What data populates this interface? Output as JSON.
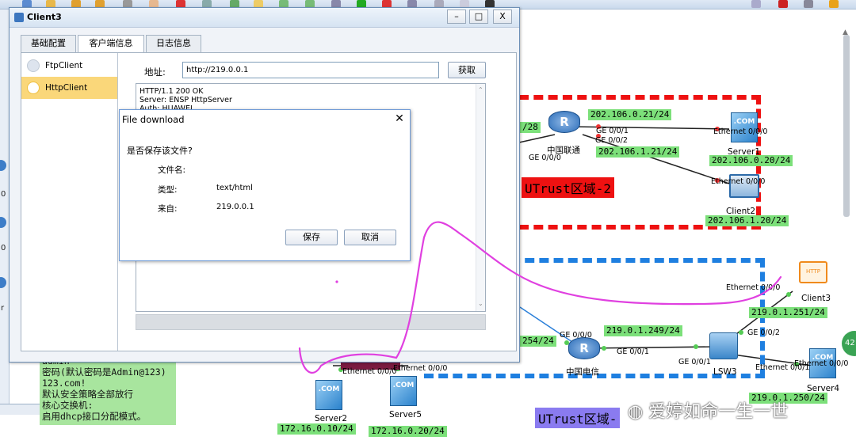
{
  "window": {
    "title": "Client3",
    "tabs": [
      "基础配置",
      "客户端信息",
      "日志信息"
    ],
    "active_tab": "客户端信息",
    "client_list": [
      "FtpClient",
      "HttpClient"
    ],
    "selected_client": "HttpClient",
    "address_label": "地址:",
    "address_value": "http://219.0.0.1",
    "fetch_button": "获取",
    "response_lines": [
      "HTTP/1.1 200 OK",
      "Server: ENSP HttpServer",
      "Auth: HUAWEI"
    ]
  },
  "dialog": {
    "title": "File download",
    "question": "是否保存该文件?",
    "filename_label": "文件名:",
    "filename_value": "",
    "type_label": "类型:",
    "type_value": "text/html",
    "from_label": "来自:",
    "from_value": "219.0.0.1",
    "save_button": "保存",
    "cancel_button": "取消"
  },
  "topology": {
    "zones": [
      {
        "name": "UTrust区域-2",
        "color": "#ee1111"
      },
      {
        "name": "UTrust区域-",
        "color": "#1e7fe0"
      }
    ],
    "devices": {
      "router_unicom": "中国联通",
      "router_telecom": "中国电信",
      "server1": "Server1",
      "client2": "Client2",
      "client3": "Client3",
      "server4": "Server4",
      "lsw3": "LSW3",
      "server2": "Server2",
      "server5": "Server5"
    },
    "ip_labels": {
      "unicom_ge001": "202.106.0.21/24",
      "unicom_ge002": "202.106.1.21/24",
      "server1_ip": "202.106.0.20/24",
      "client2_ip": "202.106.1.20/24",
      "telecom_ge001": "219.0.1.249/24",
      "client3_ip": "219.0.1.251/24",
      "server4_ip": "219.0.1.250/24",
      "server2_ip": "172.16.0.10/24",
      "server5_ip": "172.16.0.20/24",
      "partial_254": "254/24",
      "partial_28": "/28"
    },
    "port_labels": {
      "ge001": "GE 0/0/1",
      "ge002": "GE 0/0/2",
      "ge000": "GE 0/0/0",
      "eth000": "Ethernet 0/0/0",
      "eth001": "Ethernet 0/0/1"
    },
    "note_lines": [
      "admin",
      "密码(默认密码是Admin@123)",
      "123.com!",
      "默认安全策略全部放行",
      "核心交换机:",
      "启用dhcp接口分配模式。"
    ],
    "watermark": "爱婷如命一生一世"
  },
  "left_strip_labels": [
    "0",
    "0",
    "r"
  ],
  "colors": {
    "ip_label_bg": "#7ce07a",
    "selected_item": "#fad77a",
    "annotation": "#e040e0"
  }
}
